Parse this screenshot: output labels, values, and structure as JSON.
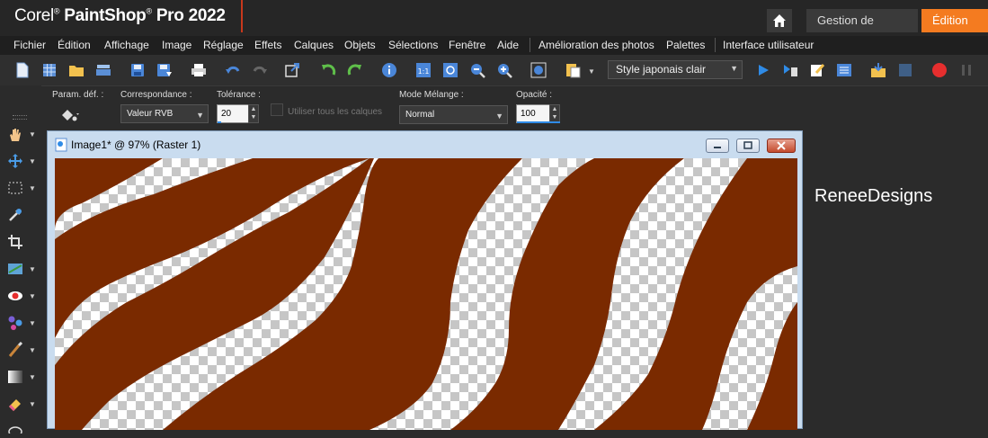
{
  "app": {
    "logo_prefix": "Corel",
    "logo_main": "PaintShop",
    "logo_pro": "Pro",
    "logo_year": "2022",
    "logo_reg": "®"
  },
  "workspace_tabs": [
    {
      "label": "Gestion de photos"
    },
    {
      "label": "Édition"
    }
  ],
  "menu": [
    {
      "label": "Fichier"
    },
    {
      "label": "Édition"
    },
    {
      "label": "Affichage"
    },
    {
      "label": "Image"
    },
    {
      "label": "Réglage"
    },
    {
      "label": "Effets"
    },
    {
      "label": "Calques"
    },
    {
      "label": "Objets"
    },
    {
      "label": "Sélections"
    },
    {
      "label": "Fenêtre"
    },
    {
      "label": "Aide"
    },
    {
      "label": "Amélioration des photos"
    },
    {
      "label": "Palettes"
    },
    {
      "label": "Interface utilisateur"
    }
  ],
  "toolbar": {
    "style_value": "Style japonais clair"
  },
  "options": {
    "param_label": "Param. déf. :",
    "correspondance_label": "Correspondance :",
    "correspondance_value": "Valeur RVB",
    "tolerance_label": "Tolérance :",
    "tolerance_value": "20",
    "all_layers_label": "Utiliser tous les calques",
    "blend_label": "Mode Mélange :",
    "blend_value": "Normal",
    "opacity_label": "Opacité :",
    "opacity_value": "100"
  },
  "image_window": {
    "title": "Image1* @  97% (Raster 1)"
  },
  "watermark": "ReneeDesigns",
  "colors": {
    "accent_orange": "#f47b20",
    "canvas_fill": "#7a2a00",
    "record_red": "#e62e2e",
    "play_blue": "#2f8be6"
  }
}
